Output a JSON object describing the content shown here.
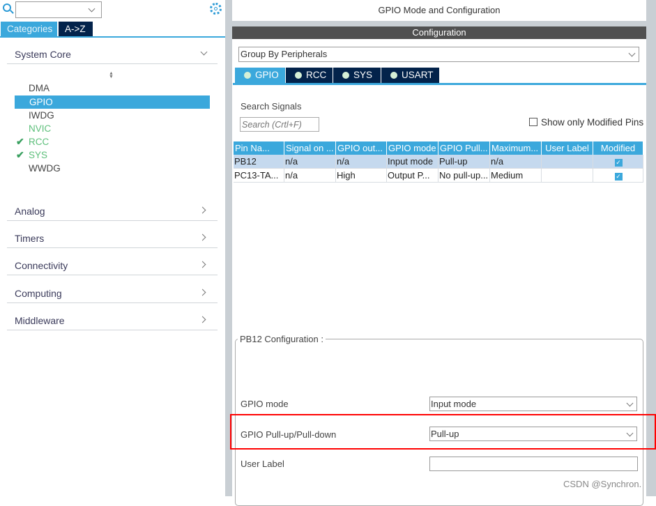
{
  "left": {
    "search_value": "",
    "tabs": [
      {
        "label": "Categories",
        "active": true
      },
      {
        "label": "A->Z",
        "active": false
      }
    ],
    "categories": [
      {
        "label": "System Core",
        "expanded": true,
        "items": [
          {
            "label": "DMA",
            "state": "normal"
          },
          {
            "label": "GPIO",
            "state": "selected"
          },
          {
            "label": "IWDG",
            "state": "normal"
          },
          {
            "label": "NVIC",
            "state": "green"
          },
          {
            "label": "RCC",
            "state": "checked"
          },
          {
            "label": "SYS",
            "state": "checked"
          },
          {
            "label": "WWDG",
            "state": "normal"
          }
        ]
      },
      {
        "label": "Analog",
        "expanded": false
      },
      {
        "label": "Timers",
        "expanded": false
      },
      {
        "label": "Connectivity",
        "expanded": false
      },
      {
        "label": "Computing",
        "expanded": false
      },
      {
        "label": "Middleware",
        "expanded": false
      }
    ]
  },
  "main": {
    "title": "GPIO Mode and Configuration",
    "config_header": "Configuration",
    "group_by": "Group By Peripherals",
    "tabs": [
      {
        "label": "GPIO",
        "active": true
      },
      {
        "label": "RCC"
      },
      {
        "label": "SYS"
      },
      {
        "label": "USART"
      }
    ],
    "search_label": "Search Signals",
    "search_placeholder": "Search (Crtl+F)",
    "show_modified_label": "Show only Modified Pins",
    "show_modified_checked": false,
    "table": {
      "columns": [
        "Pin Na...",
        "Signal on ...",
        "GPIO out...",
        "GPIO mode",
        "GPIO Pull...",
        "Maximum...",
        "User Label",
        "Modified"
      ],
      "rows": [
        {
          "cells": [
            "PB12",
            "n/a",
            "n/a",
            "Input mode",
            "Pull-up",
            "n/a",
            ""
          ],
          "modified": true,
          "selected": true
        },
        {
          "cells": [
            "PC13-TA...",
            "n/a",
            "High",
            "Output P...",
            "No pull-up...",
            "Medium",
            ""
          ],
          "modified": true,
          "selected": false
        }
      ]
    },
    "pin_config": {
      "title": "PB12 Configuration :",
      "gpio_mode_label": "GPIO mode",
      "gpio_mode_value": "Input mode",
      "pull_label": "GPIO Pull-up/Pull-down",
      "pull_value": "Pull-up",
      "user_label_label": "User Label",
      "user_label_value": ""
    }
  },
  "colors": {
    "accent": "#3ba8dc",
    "navy": "#03234b",
    "highlight": "#ff0000",
    "selected_row": "#c5d9ee"
  },
  "watermark": "CSDN @Synchron."
}
